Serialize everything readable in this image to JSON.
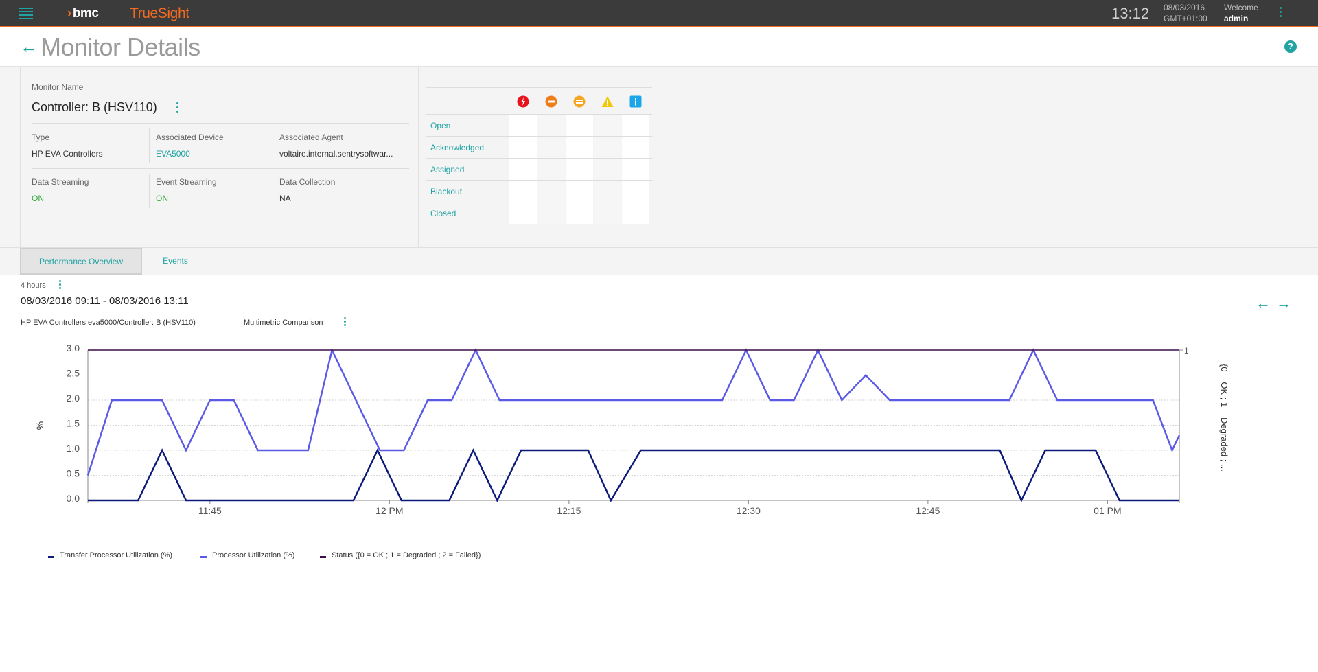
{
  "topbar": {
    "brand": "bmc",
    "product": "TrueSight",
    "clock": "13:12",
    "date": "08/03/2016",
    "timezone": "GMT+01:00",
    "welcome_label": "Welcome",
    "user": "admin",
    "accent_color": "#f26b21",
    "teal_color": "#1fa3a3"
  },
  "page": {
    "title": "Monitor Details"
  },
  "monitor": {
    "name_label": "Monitor Name",
    "name": "Controller: B (HSV110)",
    "type_label": "Type",
    "type": "HP EVA Controllers",
    "device_label": "Associated Device",
    "device": "EVA5000",
    "agent_label": "Associated Agent",
    "agent": "voltaire.internal.sentrysoftwar...",
    "data_streaming_label": "Data Streaming",
    "data_streaming": "ON",
    "event_streaming_label": "Event Streaming",
    "event_streaming": "ON",
    "data_collection_label": "Data Collection",
    "data_collection": "NA"
  },
  "events_matrix": {
    "severities": [
      {
        "name": "critical-icon",
        "color": "#e8141c"
      },
      {
        "name": "major-icon",
        "color": "#f07c1a"
      },
      {
        "name": "minor-icon",
        "color": "#f5a623"
      },
      {
        "name": "warning-icon",
        "color": "#f2c80f"
      },
      {
        "name": "info-icon",
        "color": "#1aa6e8"
      }
    ],
    "rows": [
      "Open",
      "Acknowledged",
      "Assigned",
      "Blackout",
      "Closed"
    ]
  },
  "tabs": [
    "Performance Overview",
    "Events"
  ],
  "range": {
    "duration": "4 hours",
    "text": "08/03/2016 09:11 - 08/03/2016 13:11"
  },
  "chart_header": {
    "source": "HP EVA Controllers eva5000/Controller: B (HSV110)",
    "type": "Multimetric Comparison"
  },
  "chart_data": {
    "type": "line",
    "ylabel": "%",
    "y2label": "{0 = OK ; 1 = Degraded ; ...",
    "ylim": [
      0,
      3
    ],
    "y_ticks": [
      "3.0",
      "2.5",
      "2.0",
      "1.5",
      "1.0",
      "0.5",
      "0.0"
    ],
    "y2_ticks": [
      "1"
    ],
    "x_ticks": [
      {
        "label": "11:45",
        "min": 45
      },
      {
        "label": "12 PM",
        "min": 60
      },
      {
        "label": "12:15",
        "min": 75
      },
      {
        "label": "12:30",
        "min": 90
      },
      {
        "label": "12:45",
        "min": 105
      },
      {
        "label": "01 PM",
        "min": 120
      }
    ],
    "xrange_min": [
      34.8,
      126
    ],
    "grid": true,
    "legend_position": "bottom-left",
    "series": [
      {
        "name": "Transfer Processor Utilization (%)",
        "color": "#0d1a7a",
        "min": [
          34.8,
          39,
          41,
          43,
          45,
          49,
          53,
          57,
          59,
          61,
          63,
          65,
          67,
          69,
          71,
          73,
          75,
          76.6,
          78.5,
          81,
          85,
          89,
          93,
          97,
          101,
          105,
          109,
          111,
          112.8,
          114.8,
          117,
          119,
          121,
          123,
          125,
          126
        ],
        "values": [
          0,
          0,
          1,
          0,
          0,
          0,
          0,
          0,
          1,
          0,
          0,
          0,
          1,
          0,
          1,
          1,
          1,
          1,
          0,
          1,
          1,
          1,
          1,
          1,
          1,
          1,
          1,
          1,
          0,
          1,
          1,
          1,
          0,
          0,
          0,
          0
        ]
      },
      {
        "name": "Processor Utilization (%)",
        "color": "#5a5ae6",
        "min": [
          34.8,
          36.8,
          41,
          43,
          45,
          47,
          49,
          51,
          53.2,
          55.2,
          57.2,
          59.2,
          61.2,
          63.2,
          65.2,
          67.2,
          69.2,
          71.2,
          73,
          77,
          81,
          85,
          87.8,
          89.8,
          91.8,
          93.8,
          95.8,
          97.8,
          99.8,
          101.8,
          103.8,
          107.8,
          111.8,
          113.8,
          115.8,
          117.8,
          121.8,
          123.8,
          125.4,
          126
        ],
        "values": [
          0.5,
          2,
          2,
          1,
          2,
          2,
          1,
          1,
          1,
          3,
          2,
          1,
          1,
          2,
          2,
          3,
          2,
          2,
          2,
          2,
          2,
          2,
          2,
          3,
          2,
          2,
          3,
          2,
          2.5,
          2,
          2,
          2,
          2,
          3,
          2,
          2,
          2,
          2,
          1,
          1.3
        ]
      },
      {
        "name": "Status ({0 = OK ; 1 = Degraded ; 2 = Failed})",
        "color": "#3b0d4a",
        "axis": "right",
        "min": [
          34.8,
          126
        ],
        "values": [
          1,
          1
        ]
      }
    ]
  }
}
